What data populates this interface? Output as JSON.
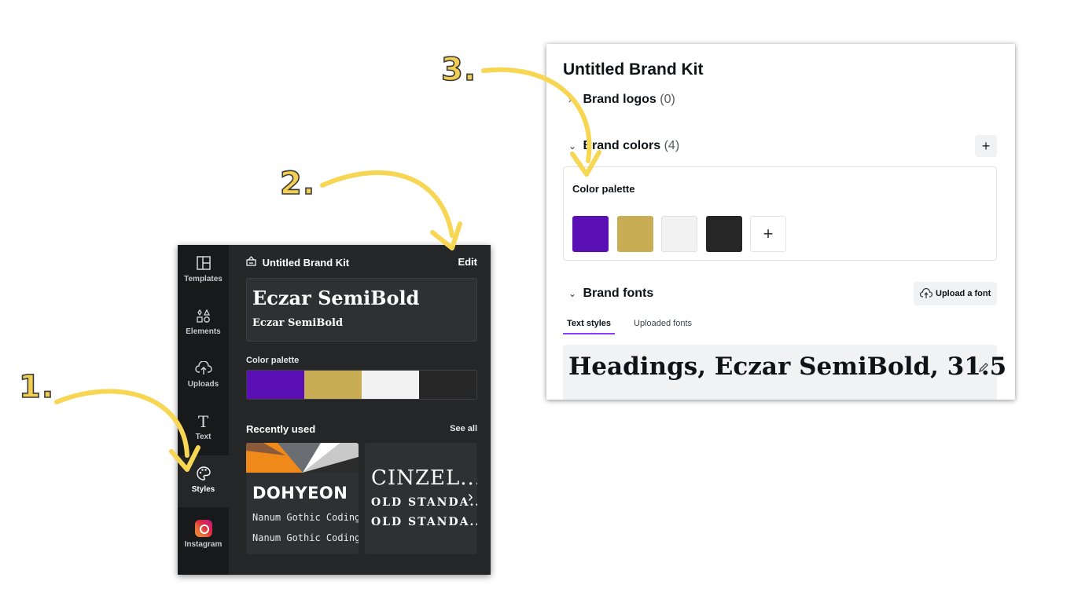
{
  "steps": [
    "1.",
    "2.",
    "3."
  ],
  "sidebar": {
    "items": [
      {
        "label": "Templates",
        "icon": "templates-icon",
        "glyph": "◫"
      },
      {
        "label": "Elements",
        "icon": "elements-icon",
        "glyph": "⬠"
      },
      {
        "label": "Uploads",
        "icon": "upload-cloud-icon",
        "glyph": "☁"
      },
      {
        "label": "Text",
        "icon": "text-icon",
        "glyph": "T"
      },
      {
        "label": "Styles",
        "icon": "palette-icon",
        "glyph": "☺"
      },
      {
        "label": "Instagram",
        "icon": "instagram-icon",
        "glyph": ""
      }
    ]
  },
  "dark_panel": {
    "kit_title": "Untitled Brand Kit",
    "edit_label": "Edit",
    "font_heading": "Eczar SemiBold",
    "font_sub": "Eczar SemiBold",
    "color_palette_label": "Color palette",
    "palette_colors": [
      "#5a0fb4",
      "#c8ad55",
      "#f2f2f2",
      "#262626"
    ],
    "recently_used_label": "Recently used",
    "see_all_label": "See all",
    "recent_card_1": {
      "title": "DOHYEON",
      "line1": "Nanum Gothic Coding",
      "line2": "Nanum Gothic Coding"
    },
    "recent_card_2": {
      "title": "CINZEL...",
      "line1": "OLD STANDA...",
      "line2": "OLD STANDA..."
    },
    "next_glyph": "›"
  },
  "brand_kit": {
    "title": "Untitled Brand Kit",
    "logos_label": "Brand logos",
    "logos_count": "(0)",
    "colors_label": "Brand colors",
    "colors_count": "(4)",
    "add_glyph": "+",
    "palette_title": "Color palette",
    "palette_colors": [
      "#5a0fb4",
      "#c8ad55",
      "#f2f2f2",
      "#262626"
    ],
    "fonts_label": "Brand fonts",
    "upload_font_label": "Upload a font",
    "tab_text_styles": "Text styles",
    "tab_uploaded_fonts": "Uploaded fonts",
    "heading_sample": "Headings, Eczar SemiBold, 31.5"
  },
  "colors": {
    "accent_purple": "#8b3dff",
    "arrow_yellow": "#f7d654"
  }
}
